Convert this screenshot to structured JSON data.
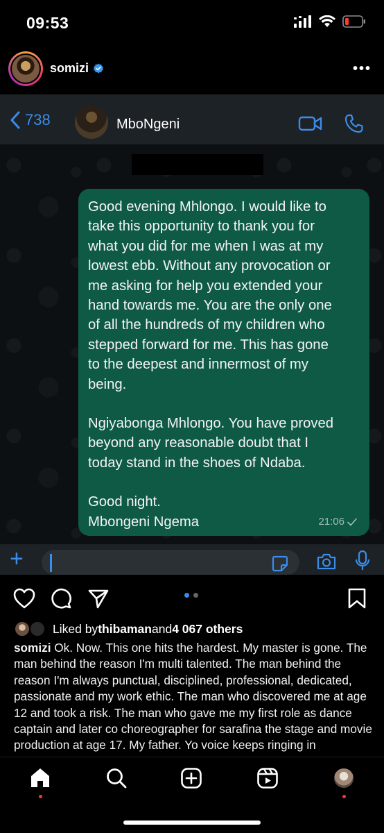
{
  "status_bar": {
    "time": "09:53",
    "icons": [
      "cellular-signal-icon",
      "wifi-icon",
      "battery-low-icon"
    ],
    "battery_color": "#ff3b30"
  },
  "post_header": {
    "username": "somizi",
    "verified": true,
    "verified_color": "#3897f0",
    "more_icon": "more-horizontal-icon"
  },
  "whatsapp": {
    "back_count": "738",
    "contact_name": "MboNgeni",
    "accent": "#3b8dea",
    "bubble_color": "#0e5a45",
    "message": {
      "paragraph_1_lines": [
        "Good evening Mhlongo. I would like to",
        "take this opportunity to thank you for",
        "what you did for me when I was at my",
        "lowest ebb. Without any provocation or",
        "me asking for help you extended your",
        "hand towards me. You are the only one",
        "of all the hundreds of my children who",
        "stepped forward for me. This has gone",
        "to the deepest and innermost of my",
        "being."
      ],
      "paragraph_2_lines": [
        "Ngiyabonga Mhlongo. You have proved",
        "beyond any reasonable doubt that I",
        "today stand in the shoes of Ndaba."
      ],
      "closing": "Good night.",
      "signature": "Mbongeni Ngema",
      "time": "21:06"
    }
  },
  "actions": {
    "icons": [
      "heart-icon",
      "comment-icon",
      "share-icon",
      "bookmark-icon"
    ],
    "carousel_slides": 2,
    "carousel_active": 1
  },
  "likes": {
    "prefix": "Liked by ",
    "user": "thibaman",
    "middle": " and ",
    "count": "4 067 others"
  },
  "caption": {
    "username": "somizi",
    "text": "Ok. Now. This one hits the hardest. My master is gone. The man behind the reason I'm multi talented. The man behind the reason I'm always punctual, disciplined, professional, dedicated, passionate and my work ethic. The man who discovered me at age 12 and took a risk. The man who gave me my first role as dance captain and later co choreographer for sarafina the stage and movie production at age 17. My father. Yo voice keeps ringing in"
  },
  "bottom_nav": {
    "items": [
      "home-icon",
      "search-icon",
      "create-post-icon",
      "reels-icon",
      "profile-avatar"
    ],
    "active": "home-icon",
    "notification_color": "#ff3040"
  }
}
